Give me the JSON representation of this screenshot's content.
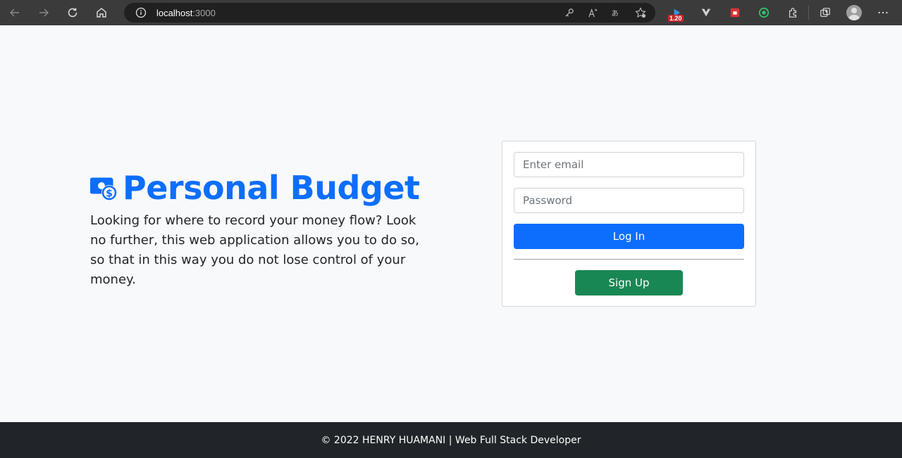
{
  "browser": {
    "url_host": "localhost",
    "url_port": ":3000",
    "extension_badge": "1.20",
    "icons": [
      "back-icon",
      "forward-icon",
      "refresh-icon",
      "home-icon",
      "info-icon",
      "key-icon",
      "read-aloud-icon",
      "translate-icon",
      "favorite-icon",
      "extension-icon",
      "collections-icon",
      "profile-icon",
      "more-icon"
    ]
  },
  "brand": {
    "title": "Personal Budget",
    "icon": "money-icon",
    "color": "#0d6efd"
  },
  "tagline": "Looking for where to record your money flow? Look no further, this web application allows you to do so, so that in this way you do not lose control of your money.",
  "login_form": {
    "email_placeholder": "Enter email",
    "email_value": "",
    "password_placeholder": "Password",
    "password_value": "",
    "login_label": "Log In",
    "signup_label": "Sign Up",
    "login_color": "#0d6efd",
    "signup_color": "#198754"
  },
  "footer": {
    "text": "© 2022 HENRY HUAMANI | Web Full Stack Developer"
  }
}
